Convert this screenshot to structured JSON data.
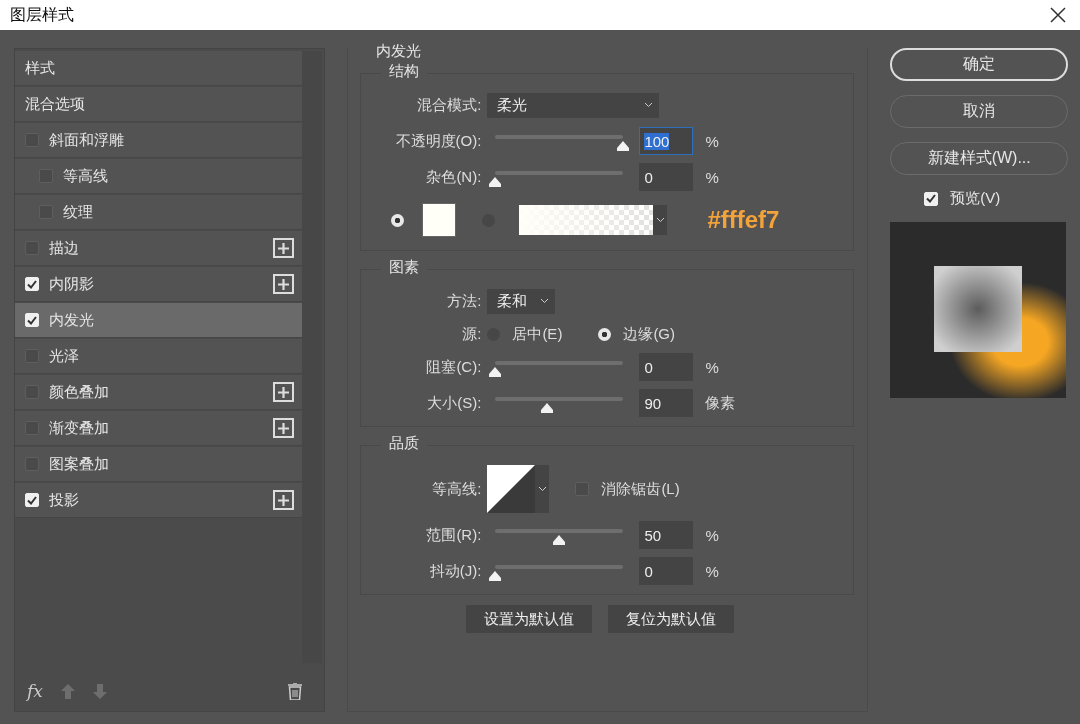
{
  "window": {
    "title": "图层样式"
  },
  "styles_list": {
    "items": [
      {
        "kind": "header",
        "label": "样式",
        "selected": false
      },
      {
        "kind": "header",
        "label": "混合选项",
        "selected": false
      },
      {
        "kind": "effect",
        "label": "斜面和浮雕",
        "checked": false,
        "selected": false,
        "add": false,
        "children": [
          {
            "kind": "effect",
            "label": "等高线",
            "checked": false,
            "selected": false,
            "add": false
          },
          {
            "kind": "effect",
            "label": "纹理",
            "checked": false,
            "selected": false,
            "add": false
          }
        ]
      },
      {
        "kind": "effect",
        "label": "描边",
        "checked": false,
        "selected": false,
        "add": true
      },
      {
        "kind": "effect",
        "label": "内阴影",
        "checked": true,
        "selected": false,
        "add": true
      },
      {
        "kind": "effect",
        "label": "内发光",
        "checked": true,
        "selected": true,
        "add": false
      },
      {
        "kind": "effect",
        "label": "光泽",
        "checked": false,
        "selected": false,
        "add": false
      },
      {
        "kind": "effect",
        "label": "颜色叠加",
        "checked": false,
        "selected": false,
        "add": true
      },
      {
        "kind": "effect",
        "label": "渐变叠加",
        "checked": false,
        "selected": false,
        "add": true
      },
      {
        "kind": "effect",
        "label": "图案叠加",
        "checked": false,
        "selected": false,
        "add": false
      },
      {
        "kind": "effect",
        "label": "投影",
        "checked": true,
        "selected": false,
        "add": true
      }
    ],
    "footer": {
      "fx": "fx"
    }
  },
  "inner_glow": {
    "title": "内发光",
    "structure": {
      "title": "结构",
      "blend_mode": {
        "label": "混合模式:",
        "value": "柔光"
      },
      "sliders": [
        {
          "label": "不透明度(O):",
          "level": 1,
          "value": "100",
          "unit": "%",
          "focused": true
        },
        {
          "label": "杂色(N):",
          "level": 0,
          "value": "0",
          "unit": "%",
          "focused": false
        }
      ],
      "fill_options": [
        {
          "kind": "swatch",
          "selected": true
        },
        {
          "kind": "gradient",
          "selected": false
        }
      ],
      "annotation": "#fffef7"
    },
    "elements": {
      "title": "图素",
      "method": {
        "label": "方法:",
        "value": "柔和"
      },
      "source": {
        "label": "源:",
        "options": [
          {
            "label": "居中(E)",
            "selected": false
          },
          {
            "label": "边缘(G)",
            "selected": true
          }
        ]
      },
      "sliders": [
        {
          "label": "阻塞(C):",
          "level": 0,
          "value": "0",
          "unit": "%",
          "focused": false
        },
        {
          "label": "大小(S):",
          "level": 0.4,
          "value": "90",
          "unit": "像素",
          "focused": false
        }
      ]
    },
    "quality": {
      "title": "品质",
      "contour": {
        "label": "等高线:"
      },
      "anti_alias": {
        "label": "消除锯齿(L)",
        "checked": false
      },
      "sliders": [
        {
          "label": "范围(R):",
          "level": 0.5,
          "value": "50",
          "unit": "%",
          "focused": false
        },
        {
          "label": "抖动(J):",
          "level": 0,
          "value": "0",
          "unit": "%",
          "focused": false
        }
      ]
    },
    "buttons": [
      "设置为默认值",
      "复位为默认值"
    ]
  },
  "actions": {
    "buttons": [
      {
        "label": "确定",
        "kind": "primary"
      },
      {
        "label": "取消",
        "kind": "normal"
      },
      {
        "label": "新建样式(W)...",
        "kind": "normal"
      }
    ],
    "preview": {
      "label": "预览(V)",
      "checked": true
    }
  }
}
